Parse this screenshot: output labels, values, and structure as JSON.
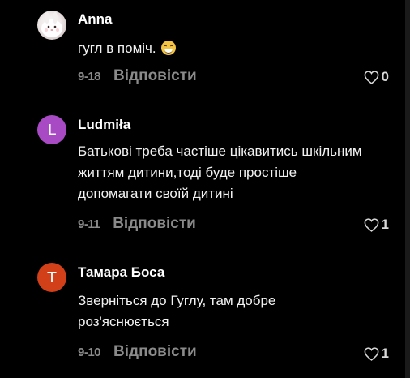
{
  "comments": [
    {
      "author": "Anna",
      "avatar_type": "photo",
      "text": "гугл в поміч.",
      "emoji": "grinning-squinting-face",
      "date": "9-18",
      "reply_label": "Відповісти",
      "likes": "0"
    },
    {
      "author": "Ludmiła",
      "avatar_letter": "L",
      "avatar_color": "#a84ac4",
      "text_lines": [
        "Батькові треба частіше цікавитись шкільним",
        "життям дитини,тоді буде простіше",
        "допомагати своїй дитині"
      ],
      "date": "9-11",
      "reply_label": "Відповісти",
      "likes": "1"
    },
    {
      "author": "Тамара Боса",
      "avatar_letter": "Т",
      "avatar_color": "#d2401a",
      "text_lines": [
        "Зверніться до Гуглу, там добре",
        "роз'яснюється"
      ],
      "date": "9-10",
      "reply_label": "Відповісти",
      "likes": "1"
    }
  ],
  "icons": {
    "like": "heart-outline-icon"
  },
  "colors": {
    "background": "#000000",
    "muted_text": "#8a8a8a"
  }
}
